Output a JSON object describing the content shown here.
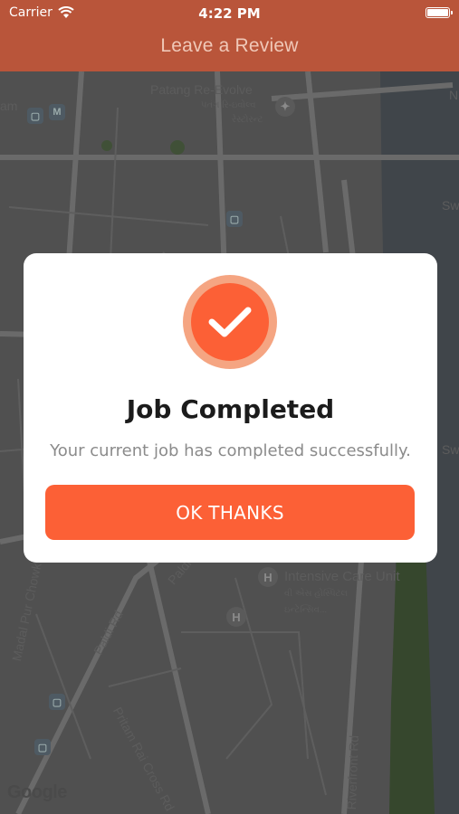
{
  "status_bar": {
    "carrier": "Carrier",
    "time": "4:22 PM"
  },
  "nav": {
    "title": "Leave a Review"
  },
  "map": {
    "labels": {
      "place_1": "Patang Re-Evolve",
      "place_1_local": "પતંગ રિ-ઇવોલ્વ",
      "place_1_local_2": "રેસ્ટોરન્ટ",
      "place_2": "Intensive Care Unit",
      "place_2_local": "વી એસ હોસ્પિટલ",
      "place_2_local_2": "ઇન્ટેન્સિવ...",
      "road_1": "Paldi Rd",
      "road_2": "Pritam Rai Cross Rd",
      "road_3": "Madal Pur Chowk",
      "road_4": "Riverfront Rd",
      "road_5": "Paldi",
      "edge_1": "Sw",
      "edge_2": "Sw",
      "edge_3": "N",
      "edge_4": "am"
    },
    "attribution": "Google"
  },
  "dialog": {
    "title": "Job Completed",
    "message": "Your current job has completed successfully.",
    "button_label": "OK THANKS"
  },
  "colors": {
    "nav_bg": "#b9553a",
    "accent": "#fc6036",
    "accent_ring": "#f5a582"
  }
}
